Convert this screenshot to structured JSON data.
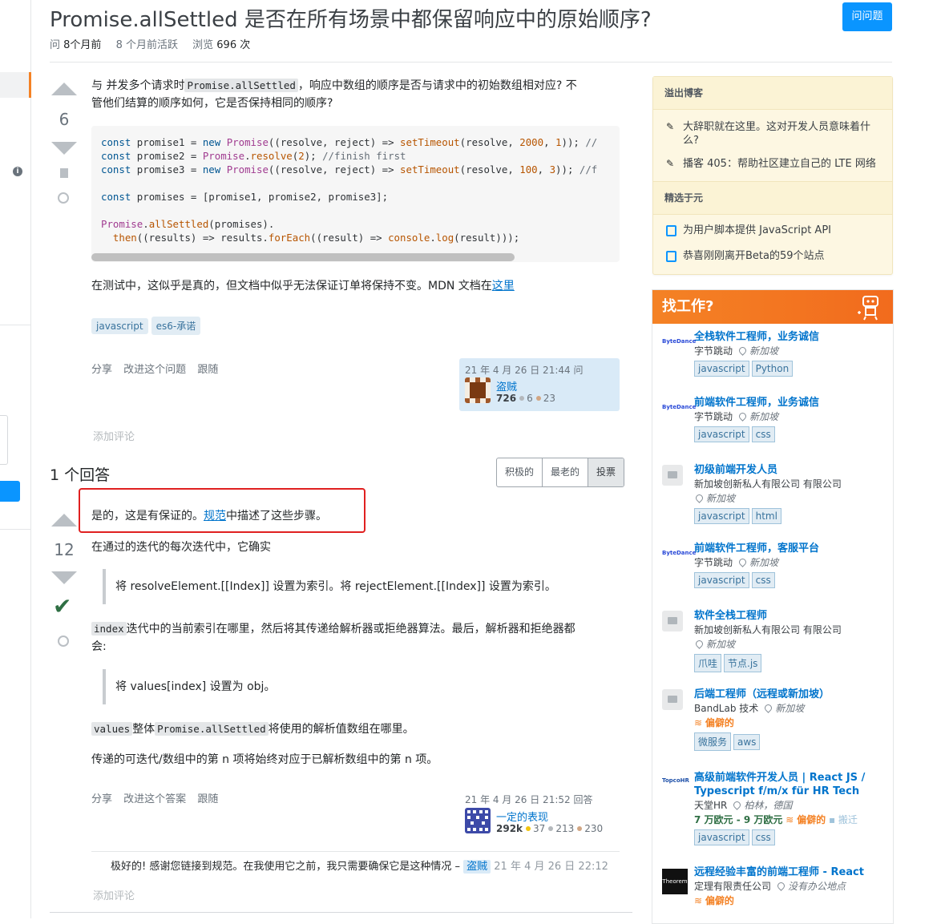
{
  "question": {
    "title": "Promise.allSettled 是否在所有场景中都保留响应中的原始顺序?",
    "ask_button": "问问题",
    "meta": {
      "asked_label": "问",
      "asked_value": "8个月前",
      "active_label": "8 个月前活跃",
      "viewed_label": "浏览",
      "viewed_value": "696 次"
    },
    "votes": "6",
    "body_line1_a": "与 并发多个请求时",
    "body_line1_code": "Promise.allSettled",
    "body_line1_b": "，响应中数组的顺序是否与请求中的初始数组相对应? 不",
    "body_line2": "管他们结算的顺序如何，它是否保持相同的顺序?",
    "code_lines": [
      "const promise1 = new Promise((resolve, reject) => setTimeout(resolve, 2000, 1)); //",
      "const promise2 = Promise.resolve(2); //finish first",
      "const promise3 = new Promise((resolve, reject) => setTimeout(resolve, 100, 3)); //f",
      "",
      "const promises = [promise1, promise2, promise3];",
      "",
      "Promise.allSettled(promises).",
      "  then((results) => results.forEach((result) => console.log(result)));"
    ],
    "after_code_text": "在测试中，这似乎是真的，但文档中似乎无法保证订单将保持不变。MDN 文档在",
    "after_code_link": "这里",
    "tags": [
      "javascript",
      "es6-承诺"
    ],
    "actions": [
      "分享",
      "改进这个问题",
      "跟随"
    ],
    "asked_time": "21 年 4 月 26 日 21:44 问",
    "user": {
      "name": "盗贼",
      "rep": "726",
      "silver": "6",
      "bronze": "23"
    },
    "add_comment": "添加评论"
  },
  "answers": {
    "header": "1 个回答",
    "sort_tabs": [
      "积极的",
      "最老的",
      "投票"
    ],
    "answer": {
      "votes": "12",
      "line1_a": "是的，这是有保证的。",
      "line1_link": "规范",
      "line1_b": "中描述了这些步骤。",
      "line2": "在通过的迭代的每次迭代中，它确实",
      "quote1": "将 resolveElement.[[Index]] 设置为索引。将 rejectElement.[[Index]] 设置为索引。",
      "p3_code": "index",
      "p3_a": "迭代中的当前索引在哪里，然后将其传递给解析器或拒绝器算法。最后，解析器和拒绝器都",
      "p3_b": "会:",
      "quote2": "将 values[index] 设置为 obj。",
      "p4_code1": "values",
      "p4_a": "整体",
      "p4_code2": "Promise.allSettled",
      "p4_b": "将使用的解析值数组在哪里。",
      "p5": "传递的可迭代/数组中的第 n 项将始终对应于已解析数组中的第 n 项。",
      "actions": [
        "分享",
        "改进这个答案",
        "跟随"
      ],
      "answered_time": "21 年 4 月 26 日 21:52 回答",
      "user": {
        "name": "一定的表现",
        "rep": "292k",
        "gold": "37",
        "silver": "213",
        "bronze": "230"
      },
      "comment": {
        "text": "极好的! 感谢您链接到规范。在我使用它之前，我只需要确保它是这种情况 –",
        "user": "盗贼",
        "time": "21 年 4 月 26 日 22:12"
      },
      "add_comment": "添加评论"
    }
  },
  "sidebar": {
    "blog": {
      "header1": "溢出博客",
      "items1": [
        "大辞职就在这里。这对开发人员意味着什么?",
        "播客 405：帮助社区建立自己的 LTE 网络"
      ],
      "header2": "精选于元",
      "items2": [
        "为用户脚本提供 JavaScript API",
        "恭喜刚刚离开Beta的59个站点"
      ]
    },
    "jobs": {
      "header": "找工作?",
      "list": [
        {
          "logo": "ByteDance",
          "title": "全栈软件工程师，业务诚信",
          "company": "字节跳动",
          "location": "新加坡",
          "tags": [
            "javascript",
            "Python"
          ]
        },
        {
          "logo": "ByteDance",
          "title": "前端软件工程师，业务诚信",
          "company": "字节跳动",
          "location": "新加坡",
          "tags": [
            "javascript",
            "css"
          ]
        },
        {
          "logo": "",
          "title": "初级前端开发人员",
          "company": "新加坡创新私人有限公司 有限公司",
          "location": "新加坡",
          "tags": [
            "javascript",
            "html"
          ]
        },
        {
          "logo": "ByteDance",
          "title": "前端软件工程师，客服平台",
          "company": "字节跳动",
          "location": "新加坡",
          "tags": [
            "javascript",
            "css"
          ]
        },
        {
          "logo": "",
          "title": "软件全栈工程师",
          "company": "新加坡创新私人有限公司 有限公司",
          "location": "新加坡",
          "tags": [
            "爪哇",
            "节点.js"
          ]
        },
        {
          "logo": "",
          "title": "后端工程师（远程或新加坡）",
          "company": "BandLab 技术",
          "location": "新加坡",
          "extra": "偏僻的",
          "tags": [
            "微服务",
            "aws"
          ]
        },
        {
          "logo": "TopcoHR",
          "title": "高级前端软件开发人员 | React JS / Typescript f/m/x für HR Tech",
          "company": "天堂HR",
          "location": "柏林，德国",
          "salary": "7 万欧元 - 9 万欧元",
          "extra": "偏僻的",
          "extra2": "搬迁",
          "tags": [
            "javascript",
            "css"
          ]
        },
        {
          "logo": "Theorem",
          "title": "远程经验丰富的前端工程师 - React",
          "company": "定理有限责任公司",
          "location": "没有办公地点",
          "extra": "偏僻的",
          "tags": []
        }
      ]
    }
  },
  "colors": {
    "accent": "#0a95ff",
    "orange": "#f48225",
    "accepted": "#2f6f44",
    "highlight": "#e02020"
  }
}
